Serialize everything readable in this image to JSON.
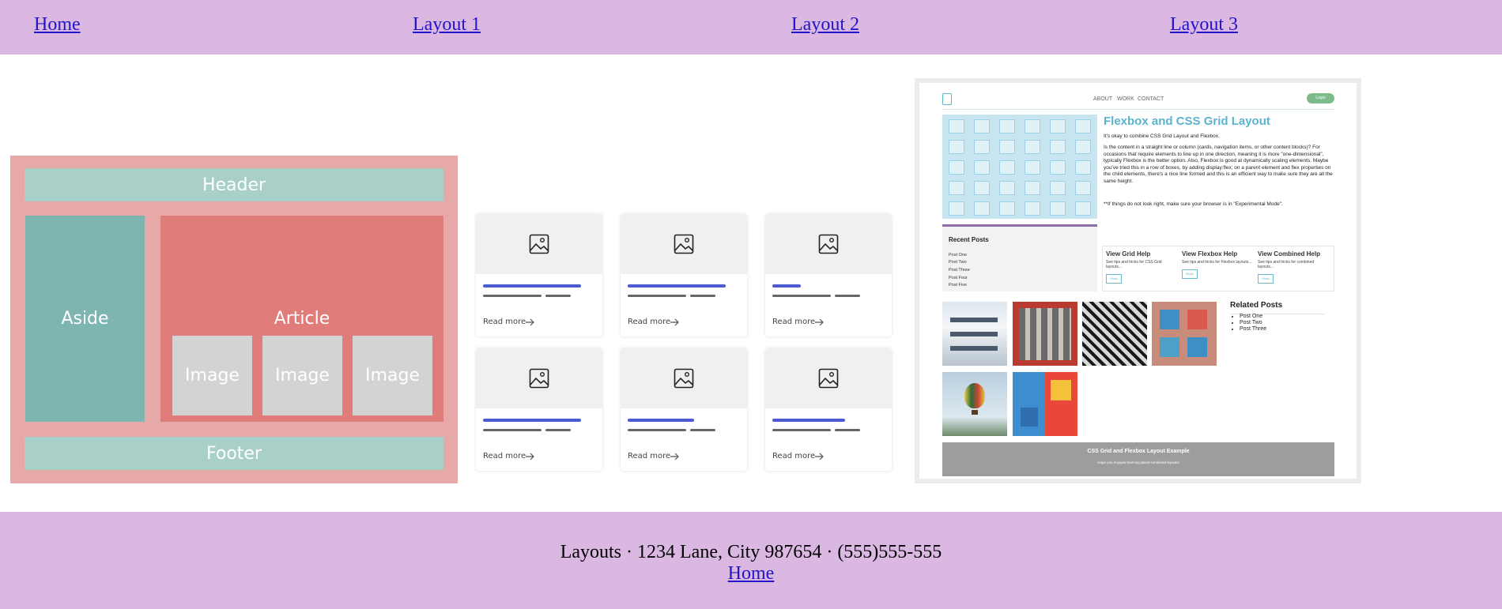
{
  "nav": {
    "links": [
      "Home",
      "Layout 1",
      "Layout 2",
      "Layout 3"
    ]
  },
  "diagram": {
    "header": "Header",
    "aside": "Aside",
    "article": "Article",
    "images": [
      "Image",
      "Image",
      "Image"
    ],
    "footer": "Footer"
  },
  "cards": {
    "read_more": [
      "Read more",
      "Read more",
      "Read more",
      "Read more",
      "Read more",
      "Read more"
    ],
    "icon": "image-placeholder-icon",
    "accent": "#4a5bd0"
  },
  "site": {
    "nav": [
      "ABOUT",
      "WORK",
      "CONTACT"
    ],
    "login": "Login",
    "title": "Flexbox and CSS Grid Layout",
    "intro": "It's okay to combine CSS Grid Layout and Flexbox.",
    "body": "Is the content in a straight line or column (cards, navigation items, or other content blocks)? For occasions that require elements to line up in one direction, meaning it is more \"one-dimensional\", typically Flexbox is the better option. Also, Flexbox is good at dynamically scaling elements. Maybe you've tried this in a row of boxes, by adding display:flex; on a parent element and flex properties on the child elements, there's a nice line formed and this is an efficient way to make sure they are all the same height.",
    "note": "**If things do not look right, make sure your browser is in \"Experimental Mode\".",
    "recent_title": "Recent Posts",
    "recent_posts": [
      "Post One",
      "Post Two",
      "Post Three",
      "Post Four",
      "Post Five"
    ],
    "help": [
      {
        "title": "View Grid Help",
        "text": "See tips and tricks for CSS Grid layouts...",
        "btn": "Read"
      },
      {
        "title": "View Flexbox Help",
        "text": "See tips and tricks for Flexbox layouts...",
        "btn": "Read"
      },
      {
        "title": "View Combined Help",
        "text": "See tips and tricks for combined layouts...",
        "btn": "Read"
      }
    ],
    "related_title": "Related Posts",
    "related_posts": [
      "Post One",
      "Post Two",
      "Post Three"
    ],
    "footer_title": "CSS Grid and Flexbox Layout Example",
    "footer_sub": "Hope you enjoyed learning about combined layouts!"
  },
  "footer": {
    "line": "Layouts · 1234 Lane, City 987654 · (555)555-555",
    "home": "Home"
  }
}
